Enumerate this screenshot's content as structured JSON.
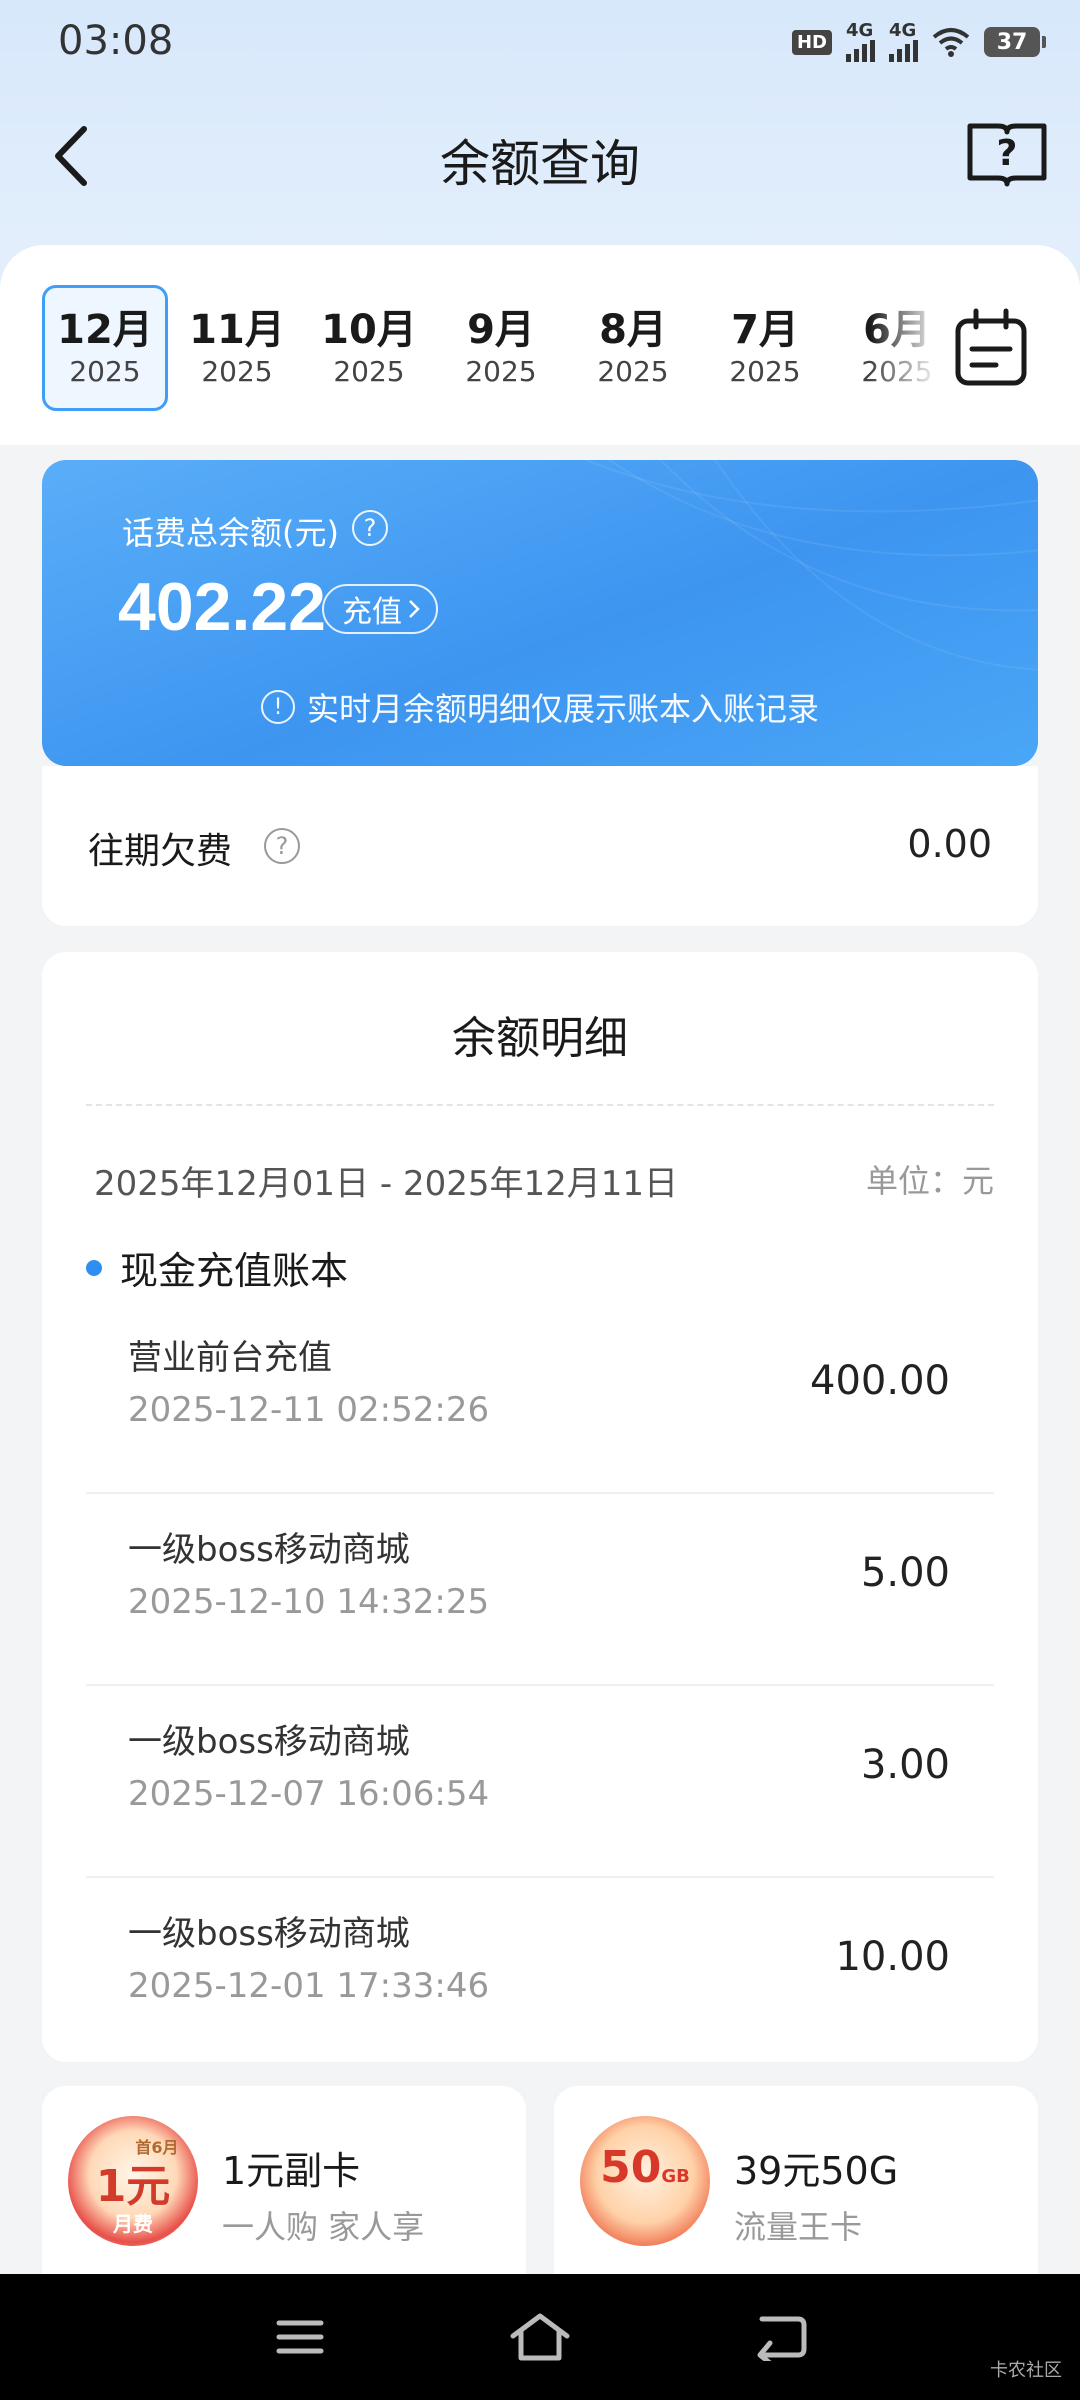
{
  "status_bar": {
    "time": "03:08",
    "hd_label": "HD",
    "sim1_net": "4G",
    "sim2_net": "4G",
    "battery": "37"
  },
  "header": {
    "title": "余额查询",
    "back_icon": "chevron-left-icon",
    "help_icon": "book-question-icon"
  },
  "months": [
    {
      "month": "12月",
      "year": "2025",
      "active": true
    },
    {
      "month": "11月",
      "year": "2025",
      "active": false
    },
    {
      "month": "10月",
      "year": "2025",
      "active": false
    },
    {
      "month": "9月",
      "year": "2025",
      "active": false
    },
    {
      "month": "8月",
      "year": "2025",
      "active": false
    },
    {
      "month": "7月",
      "year": "2025",
      "active": false
    },
    {
      "month": "6月",
      "year": "2025",
      "active": false
    }
  ],
  "balance": {
    "label": "话费总余额(元)",
    "help_glyph": "?",
    "amount": "402.22",
    "recharge_label": "充值",
    "notice": "实时月余额明细仅展示账本入账记录",
    "notice_glyph": "!"
  },
  "arrears": {
    "label": "往期欠费",
    "help_glyph": "?",
    "value": "0.00"
  },
  "details": {
    "title": "余额明细",
    "date_range": "2025年12月01日 - 2025年12月11日",
    "unit": "单位：元",
    "section_label": "现金充值账本",
    "transactions": [
      {
        "name": "营业前台充值",
        "time": "2025-12-11 02:52:26",
        "amount": "400.00"
      },
      {
        "name": "一级boss移动商城",
        "time": "2025-12-10 14:32:25",
        "amount": "5.00"
      },
      {
        "name": "一级boss移动商城",
        "time": "2025-12-07 16:06:54",
        "amount": "3.00"
      },
      {
        "name": "一级boss移动商城",
        "time": "2025-12-01 17:33:46",
        "amount": "10.00"
      }
    ]
  },
  "promos": [
    {
      "title": "1元副卡",
      "subtitle": "一人购 家人享",
      "badge_top": "首6月",
      "badge_main": "1元",
      "badge_bottom": "月费"
    },
    {
      "title": "39元50G",
      "subtitle": "流量王卡",
      "badge_main": "50",
      "badge_unit": "GB"
    }
  ],
  "nav": {
    "menu_icon": "menu-icon",
    "home_icon": "home-icon",
    "back_icon": "return-icon"
  },
  "watermark": "卡农社区",
  "colors": {
    "accent": "#3d95f0",
    "header_bg": "#d7e8fb",
    "page_bg": "#f3f4f6"
  }
}
